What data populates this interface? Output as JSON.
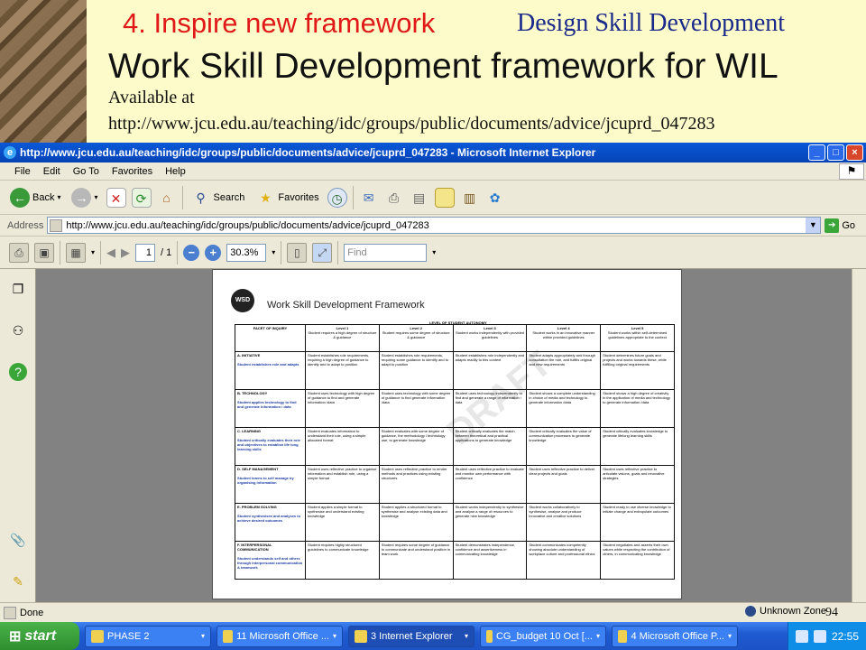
{
  "slide": {
    "subtitle": "4. Inspire new framework",
    "tag": "Design Skill Development",
    "title": "Work Skill Development framework for WIL",
    "available_label": "Available at",
    "url": "http://www.jcu.edu.au/teaching/idc/groups/public/documents/advice/jcuprd_047283",
    "slide_number": "94"
  },
  "window": {
    "title": "http://www.jcu.edu.au/teaching/idc/groups/public/documents/advice/jcuprd_047283 - Microsoft Internet Explorer"
  },
  "menu": [
    "File",
    "Edit",
    "Go To",
    "Favorites",
    "Help"
  ],
  "toolbar": {
    "back": "Back",
    "search": "Search",
    "favorites": "Favorites"
  },
  "address": {
    "label": "Address",
    "value": "http://www.jcu.edu.au/teaching/idc/groups/public/documents/advice/jcuprd_047283",
    "go": "Go"
  },
  "pdf_toolbar": {
    "page": "1",
    "page_total": "/ 1",
    "zoom": "30.3%",
    "find_placeholder": "Find"
  },
  "document": {
    "logo": "WSD",
    "title": "Work Skill Development Framework",
    "autonomy": "LEVEL OF STUDENT AUTONOMY",
    "watermark": "DRAFT",
    "facet_header": "FACET OF INQUIRY",
    "levels": [
      {
        "name": "Level 1",
        "desc": "Student requires a high degree of structure & guidance"
      },
      {
        "name": "Level 2",
        "desc": "Student requires some degree of structure & guidance"
      },
      {
        "name": "Level 3",
        "desc": "Student works independently with provided guidelines"
      },
      {
        "name": "Level 4",
        "desc": "Student works in an innovative manner within provided guidelines"
      },
      {
        "name": "Level 5",
        "desc": "Student works within self-determined guidelines appropriate to the context"
      }
    ],
    "rows": [
      {
        "facet": "A. INITIATIVE",
        "sub": "Student establishes role and adapts",
        "cells": [
          "Student establishes role requirements, requiring a high degree of guidance to identify and to adapt to position",
          "Student establishes role requirements, requiring some guidance to identify and to adapt to position",
          "Student establishes role independently and adapts readily to this context",
          "Student adapts appropriately and through consultation the role, and fulfills original and new requirements",
          "Student determines future goals and projects and works towards these, while fulfilling original requirements"
        ]
      },
      {
        "facet": "B. TECHNOLOGY",
        "sub": "Student applies technology to find and generate information / data",
        "cells": [
          "Student uses technology with high degree of guidance to find and generate information /data",
          "Student uses technology with some degree of guidance to find generate information /data",
          "Student uses technology independently to find and generate a range of information / data",
          "Student shows a complete understanding in choice of media and technology to generate information /data",
          "Student shows a high degree of creativity in the application of media and technology to generate information /data"
        ]
      },
      {
        "facet": "C. LEARNING",
        "sub": "Student critically evaluates their role and objectives to establish life long learning skills",
        "cells": [
          "Student evaluates information to understand their role, using a simple allocated format",
          "Student evaluates with some degree of guidance, the methodology / technology use, to generate knowledge",
          "Student critically evaluates the match between theoretical and practical applications to generate knowledge",
          "Student critically evaluates the value of communication processes to generate knowledge",
          "Student critically evaluates knowledge to generate lifelong learning skills"
        ]
      },
      {
        "facet": "D. SELF MANAGEMENT",
        "sub": "Student learns to self manage by organising information",
        "cells": [
          "Student uses reflective practice to organise information and establish role, using a simple format",
          "Student uses reflective practice to render methods and practices using existing structures",
          "Student uses reflective practice to evaluate and monitor own performance with confidence",
          "Student uses reflective practice to deliver clear projects and goals",
          "Student uses reflective practice to articulate visions, goals and innovative strategies"
        ]
      },
      {
        "facet": "E. PROBLEM SOLVING",
        "sub": "Student synthesises and analyses to achieve desired outcomes",
        "cells": [
          "Student applies a simple format to synthesise and understand existing knowledge",
          "Student applies a structured format to synthesise and analyse existing data and knowledge",
          "Student works independently to synthesise and analyse a range of resources to generate new knowledge",
          "Student works collaboratively to synthesise, analyse and produce innovative and creative solutions",
          "Student ready to use diverse knowledge to initiate change and extrapolate outcomes"
        ]
      },
      {
        "facet": "F. INTERPERSONAL COMMUNICATION",
        "sub": "Student understands self and others through interpersonal communication & teamwork",
        "cells": [
          "Student requires highly structured guidelines to communicate knowledge",
          "Student requires some degree of guidance to communicate and understand position in team work",
          "Student demonstrates independence, confidence and assertiveness in communicating knowledge",
          "Student communicates competently showing absolute understanding of workplace culture and professional ethics",
          "Student negotiates and asserts their own values while respecting the contribution of others, in communicating knowledge"
        ]
      }
    ]
  },
  "status": {
    "text": "Done",
    "zone": "Unknown Zone"
  },
  "taskbar": {
    "start": "start",
    "tasks": [
      {
        "label": "PHASE 2",
        "active": false
      },
      {
        "label": "11 Microsoft Office ...",
        "active": false
      },
      {
        "label": "3 Internet Explorer",
        "active": true
      },
      {
        "label": "CG_budget 10 Oct [...",
        "active": false
      },
      {
        "label": "4 Microsoft Office P...",
        "active": false
      }
    ],
    "clock": "22:55"
  }
}
